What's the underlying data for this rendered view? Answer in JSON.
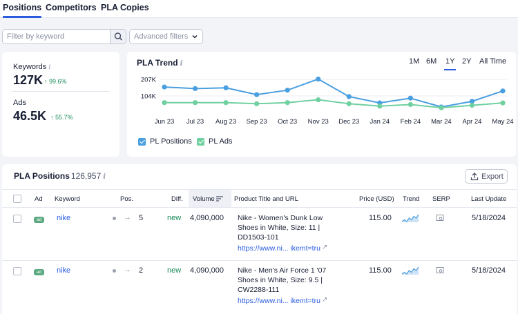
{
  "tabs": [
    "Positions",
    "Competitors",
    "PLA Copies"
  ],
  "filters": {
    "search_placeholder": "Filter by keyword",
    "advanced_label": "Advanced filters"
  },
  "stats": {
    "keywords_label": "Keywords",
    "keywords_value": "127K",
    "keywords_delta": "99.6%",
    "ads_label": "Ads",
    "ads_value": "46.5K",
    "ads_delta": "55.7%"
  },
  "trend": {
    "title": "PLA Trend",
    "ranges": [
      "1M",
      "6M",
      "1Y",
      "2Y",
      "All Time"
    ],
    "active_range": "1Y",
    "legend": {
      "positions": "PL Positions",
      "ads": "PL Ads"
    }
  },
  "chart_data": {
    "type": "line",
    "x": [
      "Jun 23",
      "Jul 23",
      "Aug 23",
      "Sep 23",
      "Oct 23",
      "Nov 23",
      "Dec 23",
      "Jan 24",
      "Feb 24",
      "Mar 24",
      "Apr 24",
      "May 24"
    ],
    "y_ticks": [
      "207K",
      "104K"
    ],
    "y_tick_values": [
      207,
      104
    ],
    "ylim": [
      0,
      260
    ],
    "series": [
      {
        "name": "PL Positions",
        "color": "#4a9fe0",
        "values": [
          160,
          150,
          155,
          112,
          140,
          210,
          100,
          60,
          90,
          35,
          70,
          135
        ]
      },
      {
        "name": "PL Ads",
        "color": "#6fd0a0",
        "values": [
          62,
          62,
          62,
          55,
          62,
          80,
          55,
          40,
          50,
          30,
          45,
          60
        ]
      }
    ]
  },
  "positions": {
    "title": "PLA Positions",
    "count": "126,957",
    "export_label": "Export",
    "columns": [
      "Ad",
      "Keyword",
      "Pos.",
      "Diff.",
      "Volume",
      "Product Title and URL",
      "Price (USD)",
      "Trend",
      "SERP",
      "Last Update"
    ],
    "rows": [
      {
        "ad": "ad",
        "keyword": "nike",
        "pos": "5",
        "diff": "new",
        "volume": "4,090,000",
        "title_lines": [
          "Nike - Women's Dunk Low",
          "Shoes in White, Size: 11 |",
          "DD1503-101"
        ],
        "url": "https://www.ni... ikemt=tru",
        "price": "115.00",
        "last_update": "5/18/2024",
        "trend": [
          3,
          4,
          3,
          5,
          4,
          6,
          5,
          7
        ]
      },
      {
        "ad": "ad",
        "keyword": "nike",
        "pos": "2",
        "diff": "new",
        "volume": "4,090,000",
        "title_lines": [
          "Nike - Men's Air Force 1 '07",
          "Shoes in White, Size: 9.5 |",
          "CW2288-111"
        ],
        "url": "https://www.ni... ikemt=tru",
        "price": "115.00",
        "last_update": "5/18/2024",
        "trend": [
          3,
          4,
          3,
          5,
          4,
          6,
          5,
          7
        ]
      }
    ]
  },
  "colors": {
    "accent": "#2b5ce0",
    "positive": "#1a8a5c",
    "line_positions": "#4a9fe0",
    "line_ads": "#6fd0a0"
  },
  "icons": [
    "search-icon",
    "chevron-down-icon",
    "info-icon",
    "arrow-up-icon",
    "export-icon",
    "arrow-right-icon",
    "sort-icon",
    "external-link-icon",
    "serp-icon"
  ]
}
